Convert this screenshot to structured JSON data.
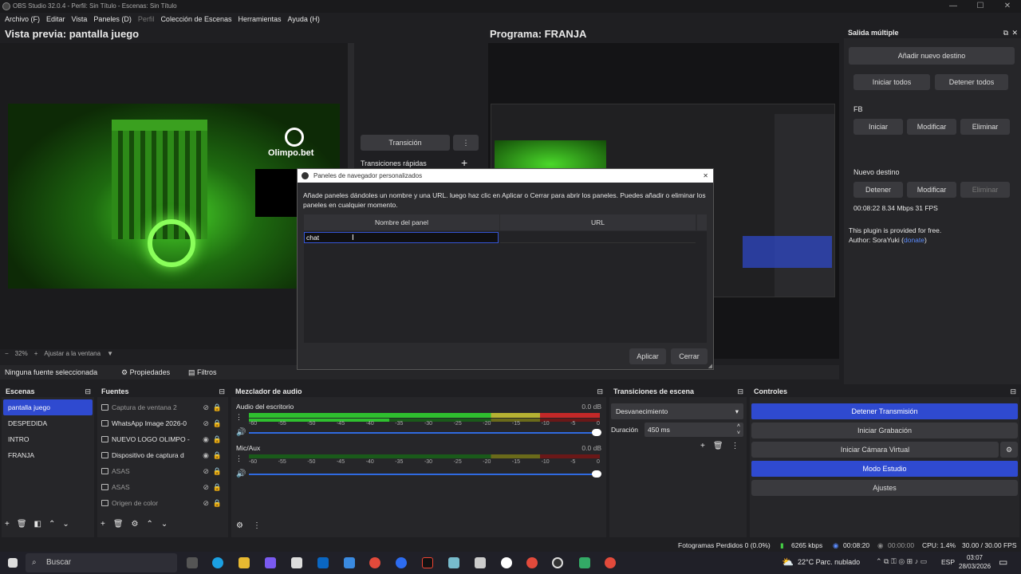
{
  "window": {
    "title": "OBS Studio 32.0.4 - Perfil: Sin Título - Escenas: Sin Título"
  },
  "menu": {
    "items": [
      "Archivo (F)",
      "Editar",
      "Vista",
      "Paneles (D)",
      "Perfil",
      "Colección de Escenas",
      "Herramientas",
      "Ayuda (H)"
    ]
  },
  "preview": {
    "title": "Vista previa: pantalla juego",
    "zoom": "32%",
    "fit": "Ajustar a la ventana",
    "brand": "Olimpo.bet"
  },
  "program": {
    "title": "Programa: FRANJA",
    "transition_btn": "Transición",
    "quick_transitions": "Transiciones rápidas"
  },
  "source_bar": {
    "no_source": "Ninguna fuente seleccionada",
    "properties": "Propiedades",
    "filters": "Filtros"
  },
  "multi": {
    "title": "Salida múltiple",
    "add": "Añadir nuevo destino",
    "start_all": "Iniciar todos",
    "stop_all": "Detener todos",
    "fb_label": "FB",
    "fb_start": "Iniciar",
    "fb_modify": "Modificar",
    "fb_delete": "Eliminar",
    "new_label": "Nuevo destino",
    "new_stop": "Detener",
    "new_modify": "Modificar",
    "new_delete": "Eliminar",
    "stats": "00:08:22  8.34 Mbps  31 FPS",
    "free": "This plugin is provided for free.",
    "author": "Author: SoraYuki (",
    "donate": "donate",
    "author_end": ")"
  },
  "dialog": {
    "title": "Paneles de navegador personalizados",
    "desc": "Añade paneles dándoles un nombre y una URL. luego haz clic en Aplicar o Cerrar para abrir los paneles. Puedes añadir o eliminar los paneles en cualquier momento.",
    "col_name": "Nombre del panel",
    "col_url": "URL",
    "input_value": "chat",
    "apply": "Aplicar",
    "close": "Cerrar"
  },
  "scenes": {
    "title": "Escenas",
    "items": [
      "pantalla juego",
      "DESPEDIDA",
      "INTRO",
      "FRANJA"
    ]
  },
  "sources": {
    "title": "Fuentes",
    "items": [
      "Captura de ventana 2",
      "WhatsApp Image 2026-0",
      "NUEVO LOGO OLIMPO -",
      "Dispositivo de captura d",
      "ASAS",
      "ASAS",
      "Origen de color"
    ]
  },
  "mixer": {
    "title": "Mezclador de audio",
    "ch1": "Audio del escritorio",
    "ch1_db": "0.0 dB",
    "ch2": "Mic/Aux",
    "ch2_db": "0.0 dB",
    "ticks": [
      "-60",
      "-55",
      "-50",
      "-45",
      "-40",
      "-35",
      "-30",
      "-25",
      "-20",
      "-15",
      "-10",
      "-5",
      "0"
    ]
  },
  "transitions": {
    "title": "Transiciones de escena",
    "selected": "Desvanecimiento",
    "duration_label": "Duración",
    "duration": "450 ms"
  },
  "controls": {
    "title": "Controles",
    "stop_stream": "Detener Transmisión",
    "start_rec": "Iniciar Grabación",
    "virtual_cam": "Iniciar Cámara Virtual",
    "studio": "Modo Estudio",
    "settings": "Ajustes"
  },
  "status": {
    "dropped": "Fotogramas Perdidos 0 (0.0%)",
    "kbps": "6265 kbps",
    "live": "00:08:20",
    "rec": "00:00:00",
    "cpu": "CPU: 1.4%",
    "fps": "30.00 / 30.00 FPS"
  },
  "taskbar": {
    "search": "Buscar",
    "weather": "22°C  Parc. nublado",
    "lang": "ESP",
    "time": "03:07",
    "date": "28/03/2026"
  },
  "colors": {
    "accent": "#2f4ad0",
    "bg": "#1f1f22"
  }
}
